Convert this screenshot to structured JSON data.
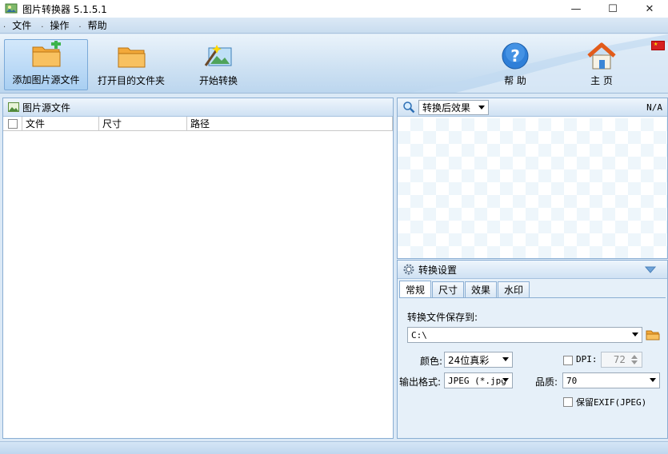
{
  "window": {
    "title": "图片转换器 5.1.5.1",
    "controls": {
      "minimize": "—",
      "maximize": "☐",
      "close": "✕"
    }
  },
  "menu": {
    "items": [
      {
        "label": "文件"
      },
      {
        "label": "操作"
      },
      {
        "label": "帮助"
      }
    ]
  },
  "toolbar": {
    "add_source": "添加图片源文件",
    "open_dest": "打开目的文件夹",
    "start_convert": "开始转换",
    "help": "帮 助",
    "home": "主 页",
    "icons": {
      "add_source": "folder-add-icon",
      "open_dest": "folder-open-icon",
      "start_convert": "magic-wand-icon",
      "help": "help-icon",
      "home": "home-icon",
      "flag": "china-flag-icon"
    }
  },
  "source_panel": {
    "title": "图片源文件",
    "columns": [
      "文件",
      "尺寸",
      "路径"
    ]
  },
  "preview_panel": {
    "dropdown_value": "转换后效果",
    "size_label": "N/A"
  },
  "settings_panel": {
    "title": "转换设置",
    "tabs": [
      "常规",
      "尺寸",
      "效果",
      "水印"
    ],
    "active_tab": "常规",
    "save_to_label": "转换文件保存到:",
    "save_path": "C:\\",
    "color_label": "颜色:",
    "color_value": "24位真彩",
    "dpi_label": "DPI:",
    "dpi_value": "72",
    "format_label": "输出格式:",
    "format_value": "JPEG (*.jpg",
    "quality_label": "品质:",
    "quality_value": "70",
    "keep_exif_label": "保留EXIF(JPEG)"
  },
  "colors": {
    "accent": "#3a8ee6",
    "panel_border": "#8aaed3",
    "toolbar_bg": "#cfe2f3"
  }
}
